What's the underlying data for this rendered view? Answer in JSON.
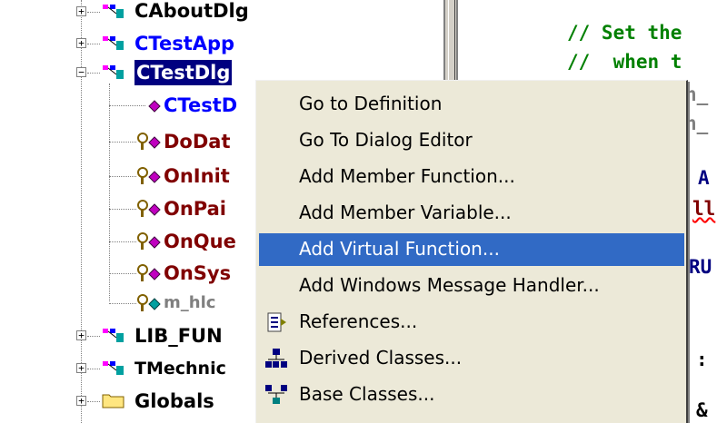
{
  "tree": {
    "nodes": [
      {
        "label": "CAboutDlg",
        "kind": "class"
      },
      {
        "label": "CTestApp",
        "kind": "class"
      },
      {
        "label": "CTestDlg",
        "kind": "class",
        "selected": true
      },
      {
        "label": "CTestD",
        "kind": "ctor"
      },
      {
        "label": "DoDat",
        "kind": "method"
      },
      {
        "label": "OnInit",
        "kind": "method"
      },
      {
        "label": "OnPai",
        "kind": "method"
      },
      {
        "label": "OnQue",
        "kind": "method"
      },
      {
        "label": "OnSys",
        "kind": "method"
      },
      {
        "label": "m_hlc",
        "kind": "member"
      },
      {
        "label": "LIB_FUN",
        "kind": "class"
      },
      {
        "label": "TMechnic",
        "kind": "class"
      },
      {
        "label": "Globals",
        "kind": "folder"
      }
    ]
  },
  "code": {
    "line1": "// Set the",
    "line2": "//  when t",
    "frag_a": "A",
    "frag_ll": "ll",
    "frag_ru": "RU",
    "frag_colon": ":",
    "frag_amp": "&",
    "frag_gray1": "n_",
    "frag_gray2": "n_"
  },
  "context_menu": {
    "items": [
      {
        "label": "Go to Definition",
        "icon": ""
      },
      {
        "label": "Go To Dialog Editor",
        "icon": ""
      },
      {
        "label": "Add Member Function...",
        "icon": ""
      },
      {
        "label": "Add Member Variable...",
        "icon": ""
      },
      {
        "label": "Add Virtual Function...",
        "icon": "",
        "highlighted": true
      },
      {
        "label": "Add Windows Message Handler...",
        "icon": ""
      },
      {
        "label": "References...",
        "icon": "references-icon"
      },
      {
        "label": "Derived Classes...",
        "icon": "derived-classes-icon"
      },
      {
        "label": "Base Classes...",
        "icon": "base-classes-icon"
      }
    ]
  },
  "colors": {
    "menu_bg": "#ece9d8",
    "highlight": "#316ac5",
    "class_name_blue": "#0000ff",
    "method_maroon": "#800000",
    "comment_green": "#008000"
  }
}
